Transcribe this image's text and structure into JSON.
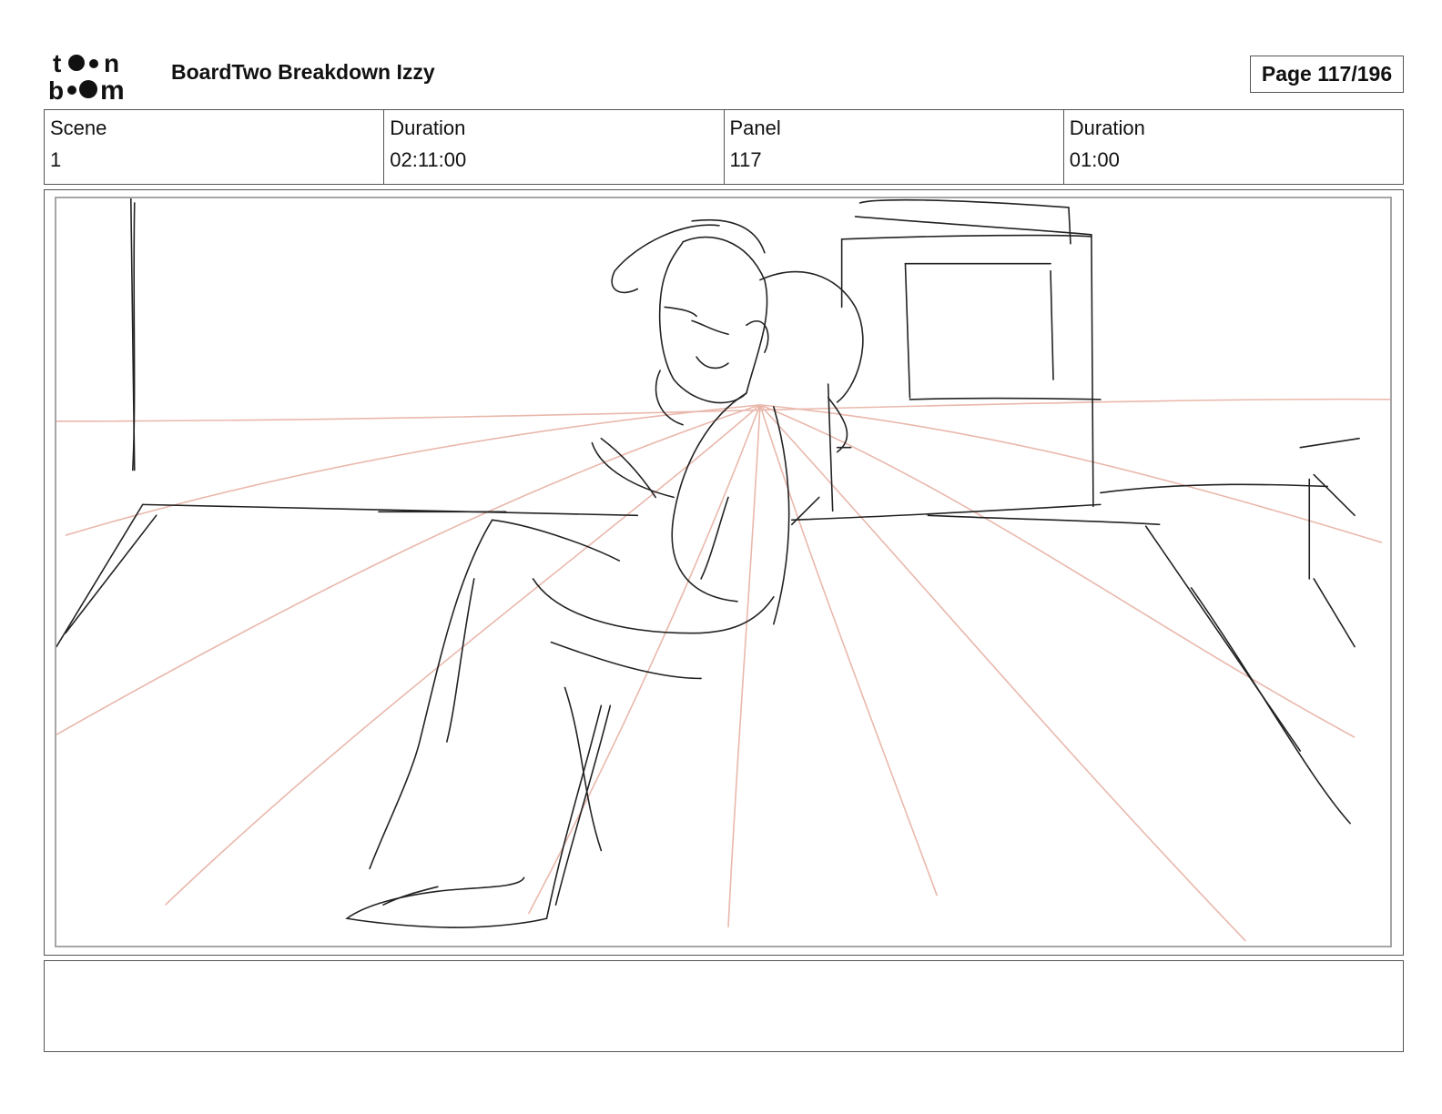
{
  "header": {
    "logo_text": "toonboom",
    "title": "BoardTwo Breakdown Izzy",
    "page_label": "Page 117/196"
  },
  "info": {
    "scene_label": "Scene",
    "scene_value": "1",
    "scene_duration_label": "Duration",
    "scene_duration_value": "02:11:00",
    "panel_label": "Panel",
    "panel_value": "117",
    "panel_duration_label": "Duration",
    "panel_duration_value": "01:00"
  },
  "panel": {
    "sketch_icon": "storyboard-sketch",
    "line_color": "#222222",
    "guide_color": "#e9b8ac"
  },
  "caption": {
    "text": ""
  }
}
